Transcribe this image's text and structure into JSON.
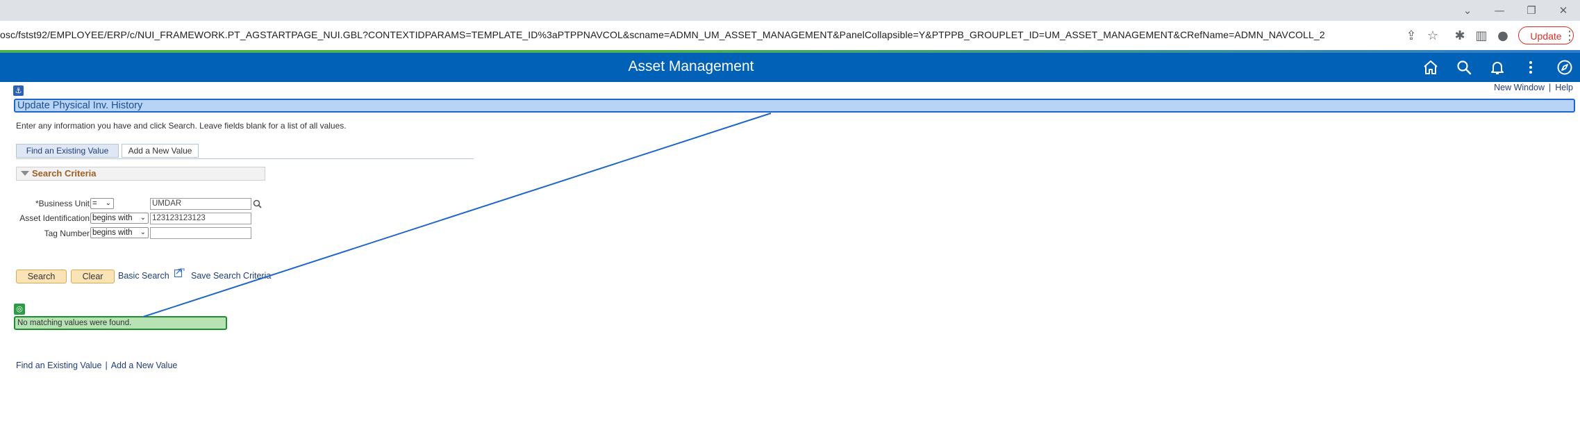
{
  "browser": {
    "url": "osc/fstst92/EMPLOYEE/ERP/c/NUI_FRAMEWORK.PT_AGSTARTPAGE_NUI.GBL?CONTEXTIDPARAMS=TEMPLATE_ID%3aPTPPNAVCOL&scname=ADMN_UM_ASSET_MANAGEMENT&PanelCollapsible=Y&PTPPB_GROUPLET_ID=UM_ASSET_MANAGEMENT&CRefName=ADMN_NAVCOLL_2",
    "update_label": "Update",
    "window_controls": [
      "chevron-down-icon",
      "minimize-icon",
      "restore-icon",
      "close-icon"
    ]
  },
  "banner": {
    "title": "Asset Management",
    "icons": [
      "home-icon",
      "search-icon",
      "bell-icon",
      "more-vert-icon",
      "navbar-compass-icon"
    ],
    "background": "#0061b6"
  },
  "header": {
    "new_window": "New Window",
    "separator": "|",
    "help": "Help"
  },
  "page": {
    "title": "Update Physical Inv. History",
    "instructions": "Enter any information you have and click Search. Leave fields blank for a list of all values."
  },
  "tabs": {
    "find_existing": "Find an Existing Value",
    "add_new": "Add a New Value"
  },
  "search_criteria": {
    "title": "Search Criteria",
    "fields": {
      "business_unit": {
        "label": "*Business Unit",
        "operator": "=",
        "value": "UMDAR"
      },
      "asset_id": {
        "label": "Asset Identification",
        "operator": "begins with",
        "value": "123123123123"
      },
      "tag_number": {
        "label": "Tag Number",
        "operator": "begins with",
        "value": ""
      }
    }
  },
  "actions": {
    "search": "Search",
    "clear": "Clear",
    "basic_search": "Basic Search",
    "save_search": "Save Search Criteria"
  },
  "message": {
    "text": "No matching values were found."
  },
  "footer": {
    "find_existing": "Find an Existing Value",
    "separator": "|",
    "add_new": "Add a New Value"
  },
  "colors": {
    "title_bar_fill": "#b7d3f5",
    "title_bar_border": "#1e66c9",
    "message_fill": "#b7e2b4",
    "message_border": "#1f8c2f",
    "annotation_line": "#1e66c9"
  }
}
